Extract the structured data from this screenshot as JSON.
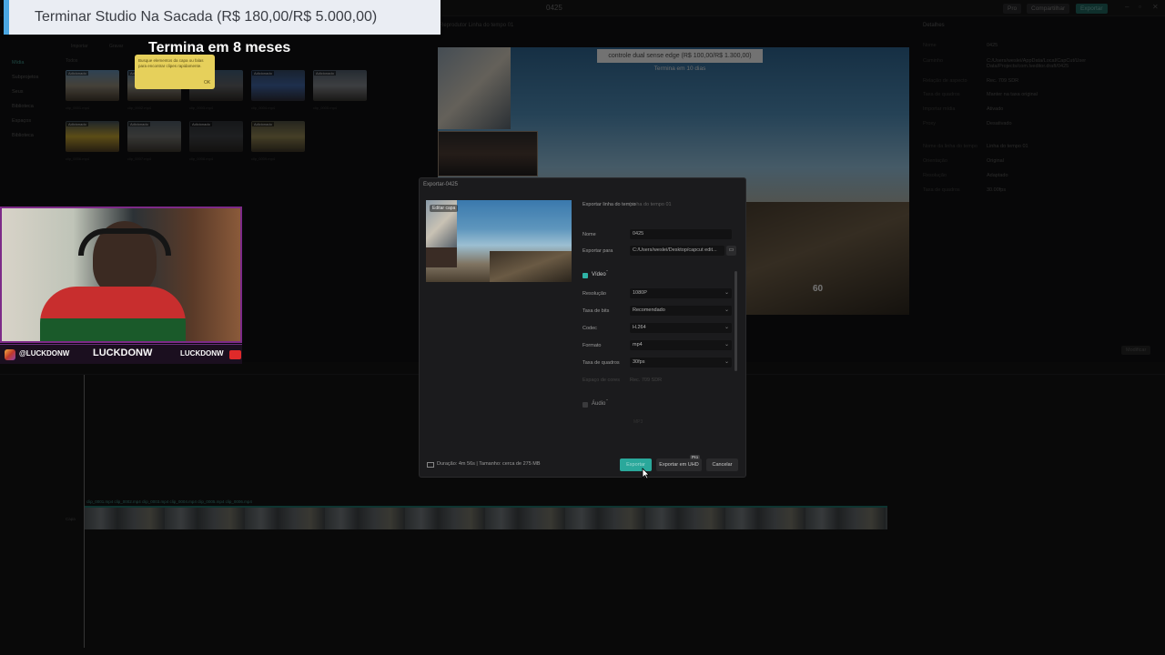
{
  "app": {
    "project_name": "0425",
    "toolbar": {
      "pro_label": "Pro",
      "share_label": "Compartilhar",
      "export_label": "Exportar"
    },
    "media_tabs": [
      "Importar",
      "Gravar"
    ],
    "side_nav": [
      "Mídia",
      "Subprojetos",
      "Seus",
      "Biblioteca",
      "Espaços",
      "Biblioteca"
    ],
    "panel_header": "Todos",
    "clips": [
      {
        "tag": "Adicionado",
        "name": "clip_0001.mp4"
      },
      {
        "tag": "Adicionado",
        "name": "clip_0002.mp4"
      },
      {
        "tag": "Adicionado",
        "name": "clip_0003.mp4"
      },
      {
        "tag": "Adicionado",
        "name": "clip_0004.mp4"
      },
      {
        "tag": "Adicionado",
        "name": "clip_0005.mp4"
      },
      {
        "tag": "Adicionado",
        "name": "clip_0006.mp4"
      },
      {
        "tag": "Adicionado",
        "name": "clip_0007.mp4"
      },
      {
        "tag": "Adicionado",
        "name": "clip_0008.mp4"
      },
      {
        "tag": "Adicionado",
        "name": "clip_0009.mp4"
      }
    ],
    "player_title": "Reprodutor Linha do tempo 01",
    "details": {
      "title": "Detalhes",
      "rows": [
        {
          "label": "Nome",
          "value": "0425"
        },
        {
          "label": "Caminho",
          "value": "C:/Users/weslei/AppData/Local/CapCut/User Data/Projects/com.lveditor.draft/0425"
        },
        {
          "label": "Relação de aspecto",
          "value": "Rec. 709 SDR"
        },
        {
          "label": "Taxa de quadros",
          "value": "Manter na taxa original"
        },
        {
          "label": "Importar mídia",
          "value": "Ativado"
        },
        {
          "label": "Proxy",
          "value": "Desativado"
        },
        {
          "label": "Nome da linha do tempo",
          "value": "Linha do tempo 01"
        },
        {
          "label": "Orientação",
          "value": "Original"
        },
        {
          "label": "Resolução",
          "value": "Adaptado"
        },
        {
          "label": "Taxa de quadros",
          "value": "30.00fps"
        }
      ],
      "modify_label": "Modificar"
    },
    "timeline": {
      "clip_label": "Capa",
      "track_names": "clip_0001.mp4   clip_0002.mp4   clip_0003.mp4   clip_0004.mp4   clip_0005.mp4   clip_0006.mp4"
    }
  },
  "stream": {
    "goal_text": "Terminar Studio Na Sacada (R$ 180,00/R$ 5.000,00)",
    "goal_sub": "Termina em 8 meses",
    "tooltip_text": "Busque elementos da capa ou falas para encontrar clipes rapidamente.",
    "tooltip_ok": "OK",
    "instagram_handle": "@LUCKDONW",
    "brand": "LUCKDONW",
    "youtube_handle": "LUCKDONW",
    "sale_title": "controle dual sense edge (R$ 100,00/R$ 1.300,00)",
    "sale_sub": "Termina em 10 dias",
    "hud_score": "60"
  },
  "dialog": {
    "title": "Exportar-0425",
    "edit_cover": "Editar capa",
    "export_timeline_label": "Exportar linha do tempo",
    "export_timeline_value": "Linha do tempo 01",
    "name_label": "Nome",
    "name_value": "0425",
    "export_to_label": "Exportar para",
    "export_to_value": "C:/Users/weslei/Desktop/capcut edit...",
    "video_section": "Vídeo",
    "resolution_label": "Resolução",
    "resolution_value": "1080P",
    "bitrate_label": "Taxa de bits",
    "bitrate_value": "Recomendado",
    "codec_label": "Codec",
    "codec_value": "H.264",
    "format_label": "Formato",
    "format_value": "mp4",
    "framerate_label": "Taxa de quadros",
    "framerate_value": "30fps",
    "color_label": "Espaço de cores",
    "color_value": "Rec. 709 SDR",
    "audio_section": "Áudio",
    "audio_format_value": "MP3",
    "footer": "Duração: 4m 56s | Tamanho: cerca de 275 MB",
    "export_btn": "Exportar",
    "export_uhd_btn": "Exportar em UHD",
    "uhd_badge": "Pro",
    "cancel_btn": "Cancelar"
  }
}
